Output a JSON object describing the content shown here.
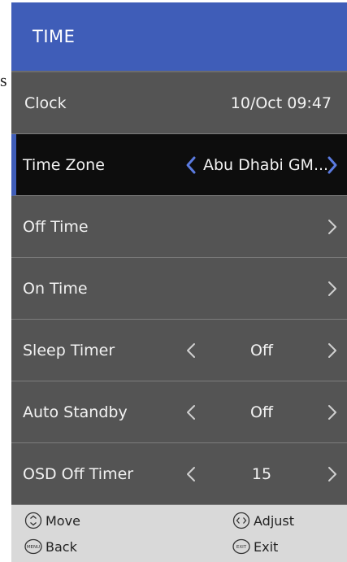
{
  "page_fragment": "s",
  "header": {
    "title": "TIME"
  },
  "clock": {
    "label": "Clock",
    "value": "10/Oct   09:47"
  },
  "rows": [
    {
      "label": "Time Zone",
      "value": "Abu Dhabi GM..."
    },
    {
      "label": "Off Time"
    },
    {
      "label": "On Time"
    },
    {
      "label": "Sleep Timer",
      "value": "Off"
    },
    {
      "label": "Auto Standby",
      "value": "Off"
    },
    {
      "label": "OSD Off Timer",
      "value": "15"
    }
  ],
  "footer": {
    "move": {
      "label": "Move",
      "icon": "up-down-icon"
    },
    "adjust": {
      "label": "Adjust",
      "icon": "left-right-icon"
    },
    "back": {
      "label": "Back",
      "icon": "menu-icon",
      "icon_text": "MENU"
    },
    "exit": {
      "label": "Exit",
      "icon": "exit-icon",
      "icon_text": "EXIT"
    }
  },
  "colors": {
    "header_bg": "#3f5db8",
    "panel_bg": "#545454",
    "selected_bg": "#0d0d0d",
    "selected_arrow": "#5b7be0",
    "footer_bg": "#d9d9d9"
  }
}
